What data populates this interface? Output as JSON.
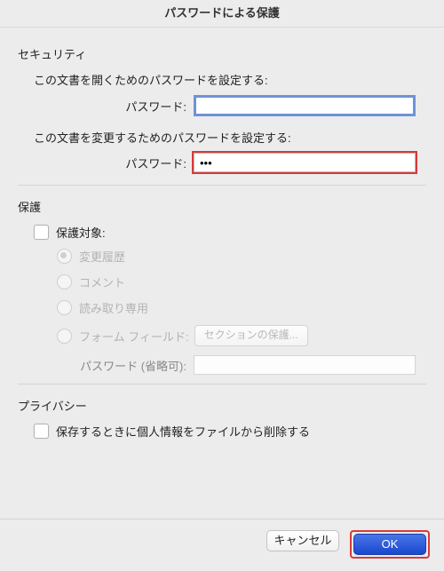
{
  "window": {
    "title": "パスワードによる保護"
  },
  "security": {
    "heading": "セキュリティ",
    "open_prompt": "この文書を開くためのパスワードを設定する:",
    "open_label": "パスワード:",
    "open_value": "",
    "modify_prompt": "この文書を変更するためのパスワードを設定する:",
    "modify_label": "パスワード:",
    "modify_value": "•••"
  },
  "protect": {
    "heading": "保護",
    "target_label": "保護対象:",
    "options": {
      "tracked_changes": "変更履歴",
      "comments": "コメント",
      "read_only": "読み取り専用",
      "form_fields": "フォーム フィールド:"
    },
    "section_button": "セクションの保護...",
    "optional_password_label": "パスワード (省略可):"
  },
  "privacy": {
    "heading": "プライバシー",
    "remove_personal_label": "保存するときに個人情報をファイルから削除する"
  },
  "buttons": {
    "cancel": "キャンセル",
    "ok": "OK"
  }
}
